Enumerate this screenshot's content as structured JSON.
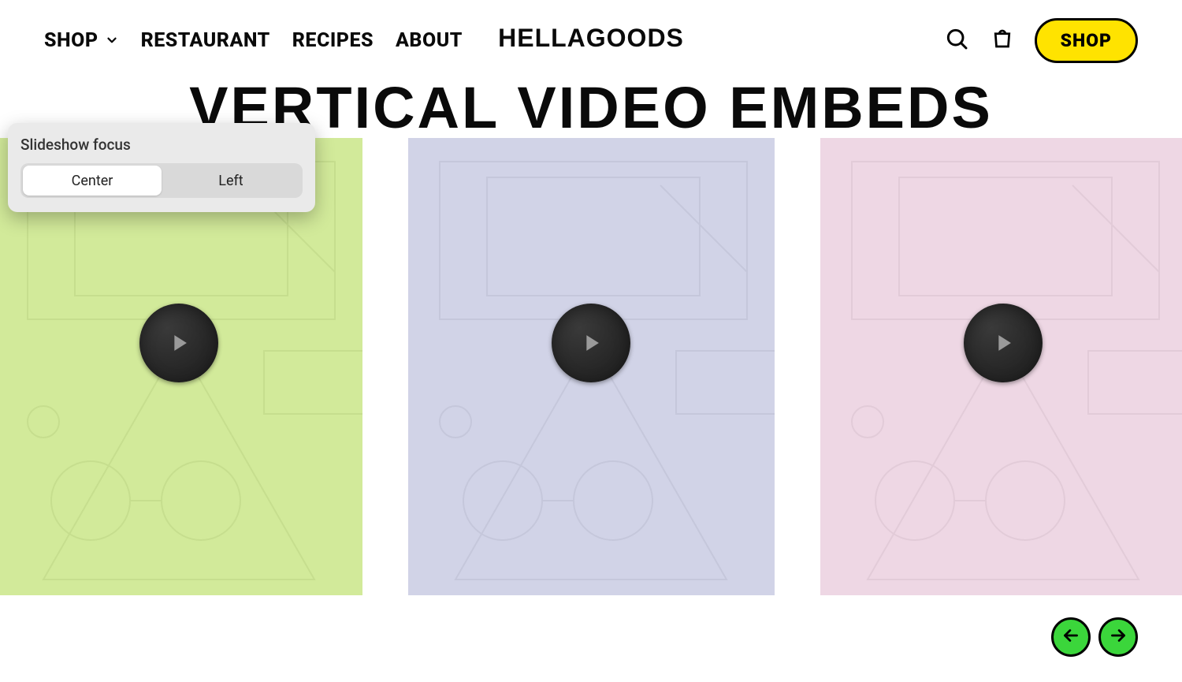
{
  "nav": {
    "items": [
      {
        "label": "SHOP",
        "hasDropdown": true
      },
      {
        "label": "RESTAURANT",
        "hasDropdown": false
      },
      {
        "label": "RECIPES",
        "hasDropdown": false
      },
      {
        "label": "ABOUT",
        "hasDropdown": false
      }
    ],
    "shop_button_label": "SHOP"
  },
  "brand": {
    "logo_text": "HELLAGOODS"
  },
  "page": {
    "title": "VERTICAL VIDEO EMBEDS"
  },
  "popover": {
    "title": "Slideshow focus",
    "options": [
      "Center",
      "Left"
    ],
    "active_index": 0
  },
  "slides": [
    {
      "tint": "green"
    },
    {
      "tint": "purple"
    },
    {
      "tint": "pink"
    }
  ],
  "colors": {
    "accent_yellow": "#ffe300",
    "nav_arrow_green": "#3bd63b"
  }
}
